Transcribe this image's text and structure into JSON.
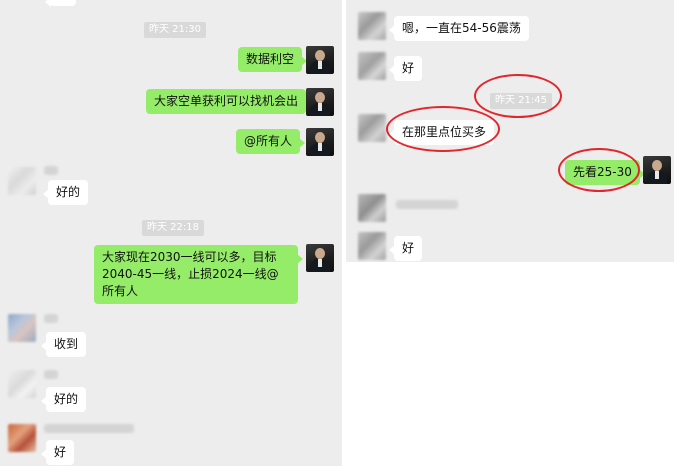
{
  "left": {
    "timestamp_1": "昨天 21:30",
    "msg_1": "数据利空",
    "msg_2": "大家空单获利可以找机会出",
    "msg_3": "@所有人",
    "msg_4": "好的",
    "timestamp_2": "昨天 22:18",
    "msg_5": "大家现在2030一线可以多，目标2040-45一线，止损2024一线@所有人",
    "msg_6": "收到",
    "msg_7": "好的",
    "msg_8": "好"
  },
  "right": {
    "msg_1": "嗯，一直在54-56震荡",
    "msg_2": "好",
    "timestamp_1": "昨天 21:45",
    "msg_3": "在那里点位买多",
    "msg_4": "先看25-30",
    "msg_5": "好"
  },
  "colors": {
    "outgoing_bubble": "#95ec69",
    "incoming_bubble": "#ffffff",
    "chat_background": "#ededed",
    "annotation_circle": "#e1262c"
  },
  "icons": [
    "user-avatar",
    "blurred-avatar"
  ]
}
